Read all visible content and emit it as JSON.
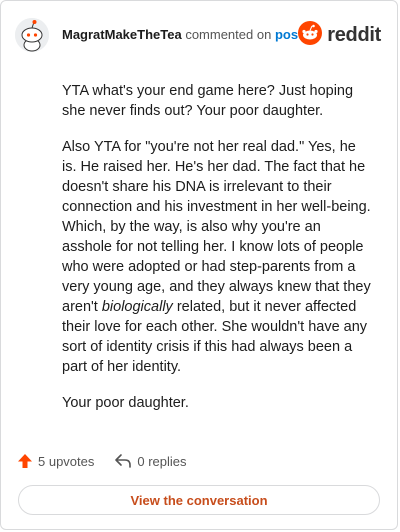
{
  "header": {
    "username": "MagratMakeTheTea",
    "action": "commented on",
    "target": "post",
    "brand": "reddit"
  },
  "comment": {
    "p1": "YTA what's your end game here? Just hoping she never finds out? Your poor daughter.",
    "p2a": "Also YTA for \"you're not her real dad.\" Yes, he is. He raised her. He's her dad. The fact that he doesn't share his DNA is irrelevant to their connection and his investment in her well-being. Which, by the way, is also why you're an asshole for not telling her. I know lots of people who were adopted or had step-parents from a very young age, and they always knew that they aren't",
    "p2b": "biologically",
    "p2c": "related, but it never affected their love for each other. She wouldn't have any sort of identity crisis if this had always been a part of her identity.",
    "p3": "Your poor daughter."
  },
  "footer": {
    "upvotes": "5 upvotes",
    "replies": "0 replies",
    "view_label": "View the conversation"
  },
  "icons": {
    "avatar": "snoo-avatar-icon",
    "brand": "reddit-logo-icon",
    "upvote": "upvote-arrow-icon",
    "reply": "reply-arrow-icon"
  },
  "colors": {
    "accent": "#ff4500",
    "link": "#0079d3",
    "button_text": "#c74d1c"
  }
}
